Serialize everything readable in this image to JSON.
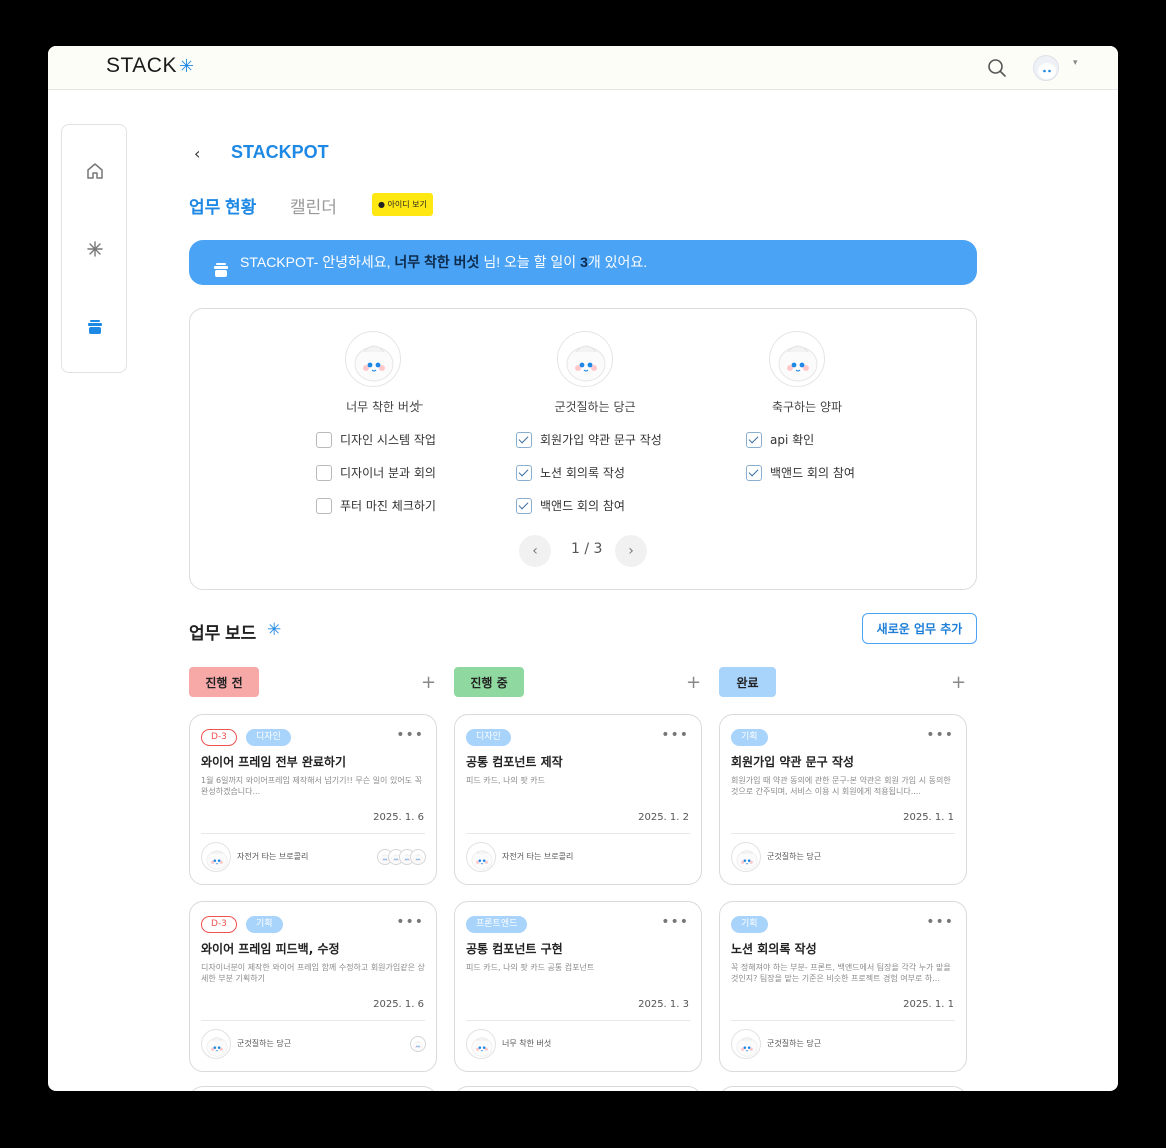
{
  "header": {
    "logo_text": "STACK",
    "logo_star": "✳",
    "search_icon": "search-icon",
    "caret": "▾"
  },
  "sidebar": {
    "items": [
      {
        "icon": "home-icon"
      },
      {
        "icon": "asterisk-icon"
      },
      {
        "icon": "pot-icon",
        "active": true
      }
    ]
  },
  "project": {
    "back": "‹",
    "title": "STACKPOT"
  },
  "tabs": {
    "active": "업무 현황",
    "inactive": "캘린더",
    "kakao_label": "아이디 보기"
  },
  "banner": {
    "prefix": "STACKPOT- 안녕하세요, ",
    "nickname": "너무 착한 버섯",
    "middle": " 님! 오늘 할 일이 ",
    "count": "3",
    "suffix": "개 있어요."
  },
  "members": [
    {
      "name": "너무 착한 버섯",
      "show_add": true,
      "todos": [
        {
          "text": "디자인 시스템 작업",
          "checked": false
        },
        {
          "text": "디자이너 분과 회의",
          "checked": false
        },
        {
          "text": "푸터 마진 체크하기",
          "checked": false
        }
      ]
    },
    {
      "name": "군것질하는 당근",
      "show_add": false,
      "todos": [
        {
          "text": "회원가입 약관 문구 작성",
          "checked": true
        },
        {
          "text": "노션 회의록 작성",
          "checked": true
        },
        {
          "text": "백앤드 회의 참여",
          "checked": true
        }
      ]
    },
    {
      "name": "축구하는 양파",
      "show_add": false,
      "todos": [
        {
          "text": "api 확인",
          "checked": true
        },
        {
          "text": "백앤드 회의 참여",
          "checked": true
        }
      ]
    }
  ],
  "pager": {
    "prev": "‹",
    "next": "›",
    "label": "1 / 3"
  },
  "board": {
    "title": "업무 보드",
    "icon": "✳",
    "new_task_label": "새로운 업무 추가",
    "columns": [
      {
        "label": "진행 전",
        "color": "#f7a9a8"
      },
      {
        "label": "진행 중",
        "color": "#8fd9a0"
      },
      {
        "label": "완료",
        "color": "#a8d3fb"
      }
    ],
    "add": "+"
  },
  "cards": [
    {
      "col": 0,
      "row": 0,
      "dday": "D-3",
      "tag": "디자인",
      "title": "와이어 프레임 전부 완료하기",
      "desc": "1월 6일까지 와이어프레임 제작해서 넘기기!! 무슨 일이 있어도 꼭 완성하겠습니다...",
      "date": "2025. 1. 6",
      "assignee": "자전거 타는 브로콜리",
      "extra_avatars": 4
    },
    {
      "col": 1,
      "row": 0,
      "dday": "",
      "tag": "디자인",
      "title": "공통 컴포넌트 제작",
      "desc": "피드 카드, 나의 팟 카드",
      "date": "2025. 1. 2",
      "assignee": "자전거 타는 브로콜리",
      "extra_avatars": 0
    },
    {
      "col": 2,
      "row": 0,
      "dday": "",
      "tag": "기획",
      "title": "회원가입 약관 문구 작성",
      "desc": "회원가입 때 약관 동의에 관한 문구-본 약관은 회원 가입 시 동의한 것으로 간주되며, 서비스 이용 시 회원에게 적용됩니다....",
      "date": "2025. 1. 1",
      "assignee": "군것질하는 당근",
      "extra_avatars": 0
    },
    {
      "col": 0,
      "row": 1,
      "dday": "D-3",
      "tag": "기획",
      "title": "와이어 프레임 피드백, 수정",
      "desc": "디자이너분이 제작한 와이어 프레임 함께 수정하고 회원가입같은 상세한 부분 기획하기",
      "date": "2025. 1. 6",
      "assignee": "군것질하는 당근",
      "extra_avatars": 1
    },
    {
      "col": 1,
      "row": 1,
      "dday": "",
      "tag": "프론트엔드",
      "title": "공통 컴포넌트 구현",
      "desc": "피드 카드, 나의 팟 카드 공통 컴포넌트",
      "date": "2025. 1. 3",
      "assignee": "너무 착한 버섯",
      "extra_avatars": 0
    },
    {
      "col": 2,
      "row": 1,
      "dday": "",
      "tag": "기획",
      "title": "노션 회의록 작성",
      "desc": "꼭 정해져야 하는 부분- 프론트, 백앤드에서 팀장을 각각 누가 맡을 것인지? 팀장을 맡는 기준은 비슷한 프로젝트 경험 여부로 하...",
      "date": "2025. 1. 1",
      "assignee": "군것질하는 당근",
      "extra_avatars": 0
    }
  ],
  "colors": {
    "accent": "#1e88e5",
    "banner": "#4ba3f5",
    "kakao": "#ffe812",
    "dday": "#ef5350",
    "tag": "#a8d3fb"
  }
}
